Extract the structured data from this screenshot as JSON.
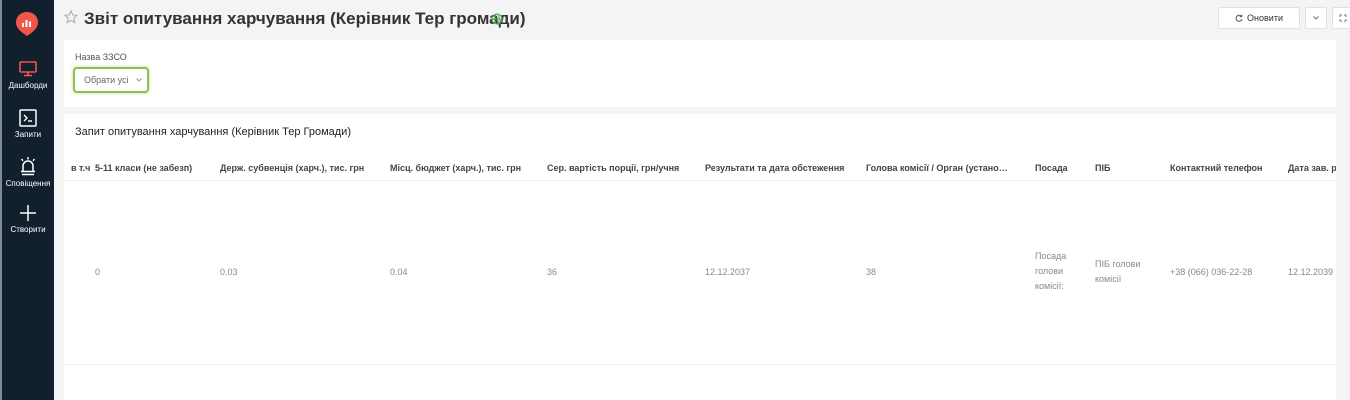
{
  "sidebar": {
    "items": [
      {
        "label": "Дашборди",
        "icon": "monitor-icon"
      },
      {
        "label": "Запити",
        "icon": "terminal-icon"
      },
      {
        "label": "Сповіщення",
        "icon": "bell-icon"
      },
      {
        "label": "Створити",
        "icon": "plus-icon"
      }
    ]
  },
  "header": {
    "title": "Звіт опитування харчування (Керівник Тер громади)",
    "refresh_label": "Оновити"
  },
  "filter": {
    "label": "Назва ЗЗСО",
    "select_value": "Обрати усі"
  },
  "table": {
    "title": "Запит опитування харчування (Керівник Тер Громади)",
    "columns": [
      "в т.ч",
      "5-11 класи (не забезп)",
      "Держ. субвенція (харч.), тис. грн",
      "Місц. бюджет (харч.), тис. грн",
      "Сер. вартість порції, грн/учня",
      "Результати та дата обстеження",
      "Голова комісії / Орган (устано…",
      "Посада",
      "ПІБ",
      "Контактний телефон",
      "Дата зав. р"
    ],
    "row": {
      "classes": "0",
      "subvention": "0.03",
      "local_budget": "0.04",
      "avg_cost": "36",
      "result_date": "12.12.2037",
      "commission": "38",
      "position_l1": "Посада",
      "position_l2": "голови",
      "position_l3": "комісії:",
      "name_l1": "ПІБ голови",
      "name_l2": "комісії",
      "phone": "+38 (066) 036-22-28",
      "date": "12.12.2039"
    }
  },
  "colors": {
    "sidebar_bg": "#12202e",
    "logo": "#f0564a",
    "select_border": "#8bc34a",
    "globe": "#4caf50"
  }
}
